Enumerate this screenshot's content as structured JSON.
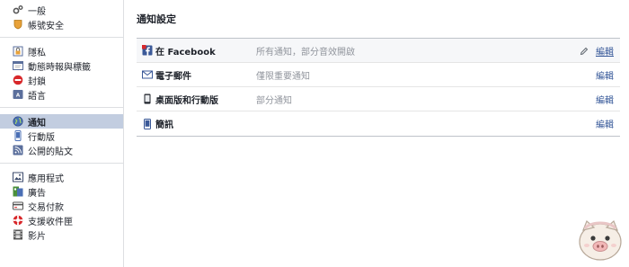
{
  "sidebar": {
    "groups": [
      {
        "items": [
          {
            "label": "一般",
            "icon": "gears-icon"
          },
          {
            "label": "帳號安全",
            "icon": "shield-icon"
          }
        ]
      },
      {
        "items": [
          {
            "label": "隱私",
            "icon": "privacy-lock-icon"
          },
          {
            "label": "動態時報與標籤",
            "icon": "timeline-icon"
          },
          {
            "label": "封鎖",
            "icon": "block-icon"
          },
          {
            "label": "語言",
            "icon": "language-icon"
          }
        ]
      },
      {
        "items": [
          {
            "label": "通知",
            "icon": "globe-icon",
            "active": true
          },
          {
            "label": "行動版",
            "icon": "mobile-icon"
          },
          {
            "label": "公開的貼文",
            "icon": "rss-icon"
          }
        ]
      },
      {
        "items": [
          {
            "label": "應用程式",
            "icon": "apps-icon"
          },
          {
            "label": "廣告",
            "icon": "ads-icon"
          },
          {
            "label": "交易付款",
            "icon": "card-icon"
          },
          {
            "label": "支援收件匣",
            "icon": "lifebuoy-icon"
          },
          {
            "label": "影片",
            "icon": "film-icon"
          }
        ]
      }
    ]
  },
  "main": {
    "title": "通知設定",
    "rows": [
      {
        "name": "在 Facebook",
        "desc": "所有通知，部分音效開啟",
        "edit": "編輯",
        "icon": "facebook-icon"
      },
      {
        "name": "電子郵件",
        "desc": "僅限重要通知",
        "edit": "編輯",
        "icon": "mail-icon"
      },
      {
        "name": "桌面版和行動版",
        "desc": "部分通知",
        "edit": "編輯",
        "icon": "phone-icon"
      },
      {
        "name": "簡訊",
        "desc": "",
        "edit": "編輯",
        "icon": "sms-phone-icon"
      }
    ]
  },
  "colors": {
    "link": "#365899",
    "active_bg": "#c2cde0",
    "muted_text": "#90949c",
    "border": "#dddfe2"
  }
}
